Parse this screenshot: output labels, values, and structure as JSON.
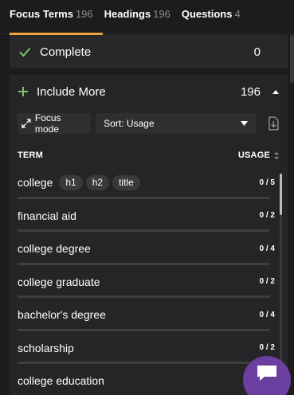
{
  "tabs": [
    {
      "label": "Focus Terms",
      "count": "196",
      "active": true
    },
    {
      "label": "Headings",
      "count": "196",
      "active": false
    },
    {
      "label": "Questions",
      "count": "4",
      "active": false
    }
  ],
  "complete": {
    "label": "Complete",
    "count": "0"
  },
  "include": {
    "label": "Include More",
    "count": "196"
  },
  "controls": {
    "focus_mode_label": "Focus mode",
    "sort_label": "Sort: Usage"
  },
  "table": {
    "term_header": "TERM",
    "usage_header": "USAGE"
  },
  "terms": [
    {
      "term": "college",
      "tags": [
        "h1",
        "h2",
        "title"
      ],
      "usage": "0 / 5"
    },
    {
      "term": "financial aid",
      "tags": [],
      "usage": "0 / 2"
    },
    {
      "term": "college degree",
      "tags": [],
      "usage": "0 / 4"
    },
    {
      "term": "college graduate",
      "tags": [],
      "usage": "0 / 2"
    },
    {
      "term": "bachelor's degree",
      "tags": [],
      "usage": "0 / 4"
    },
    {
      "term": "scholarship",
      "tags": [],
      "usage": "0 / 2"
    },
    {
      "term": "college education",
      "tags": [],
      "usage": ""
    }
  ],
  "colors": {
    "accent": "#e9a440",
    "check": "#7dc36b",
    "chat": "#6b3fa0"
  },
  "icons": {
    "check": "check-icon",
    "plus": "plus-icon",
    "caret": "caret-up-icon",
    "expand": "expand-icon",
    "dropdown": "dropdown-icon",
    "download": "download-icon",
    "sort": "sort-icon",
    "chat": "chat-icon"
  }
}
